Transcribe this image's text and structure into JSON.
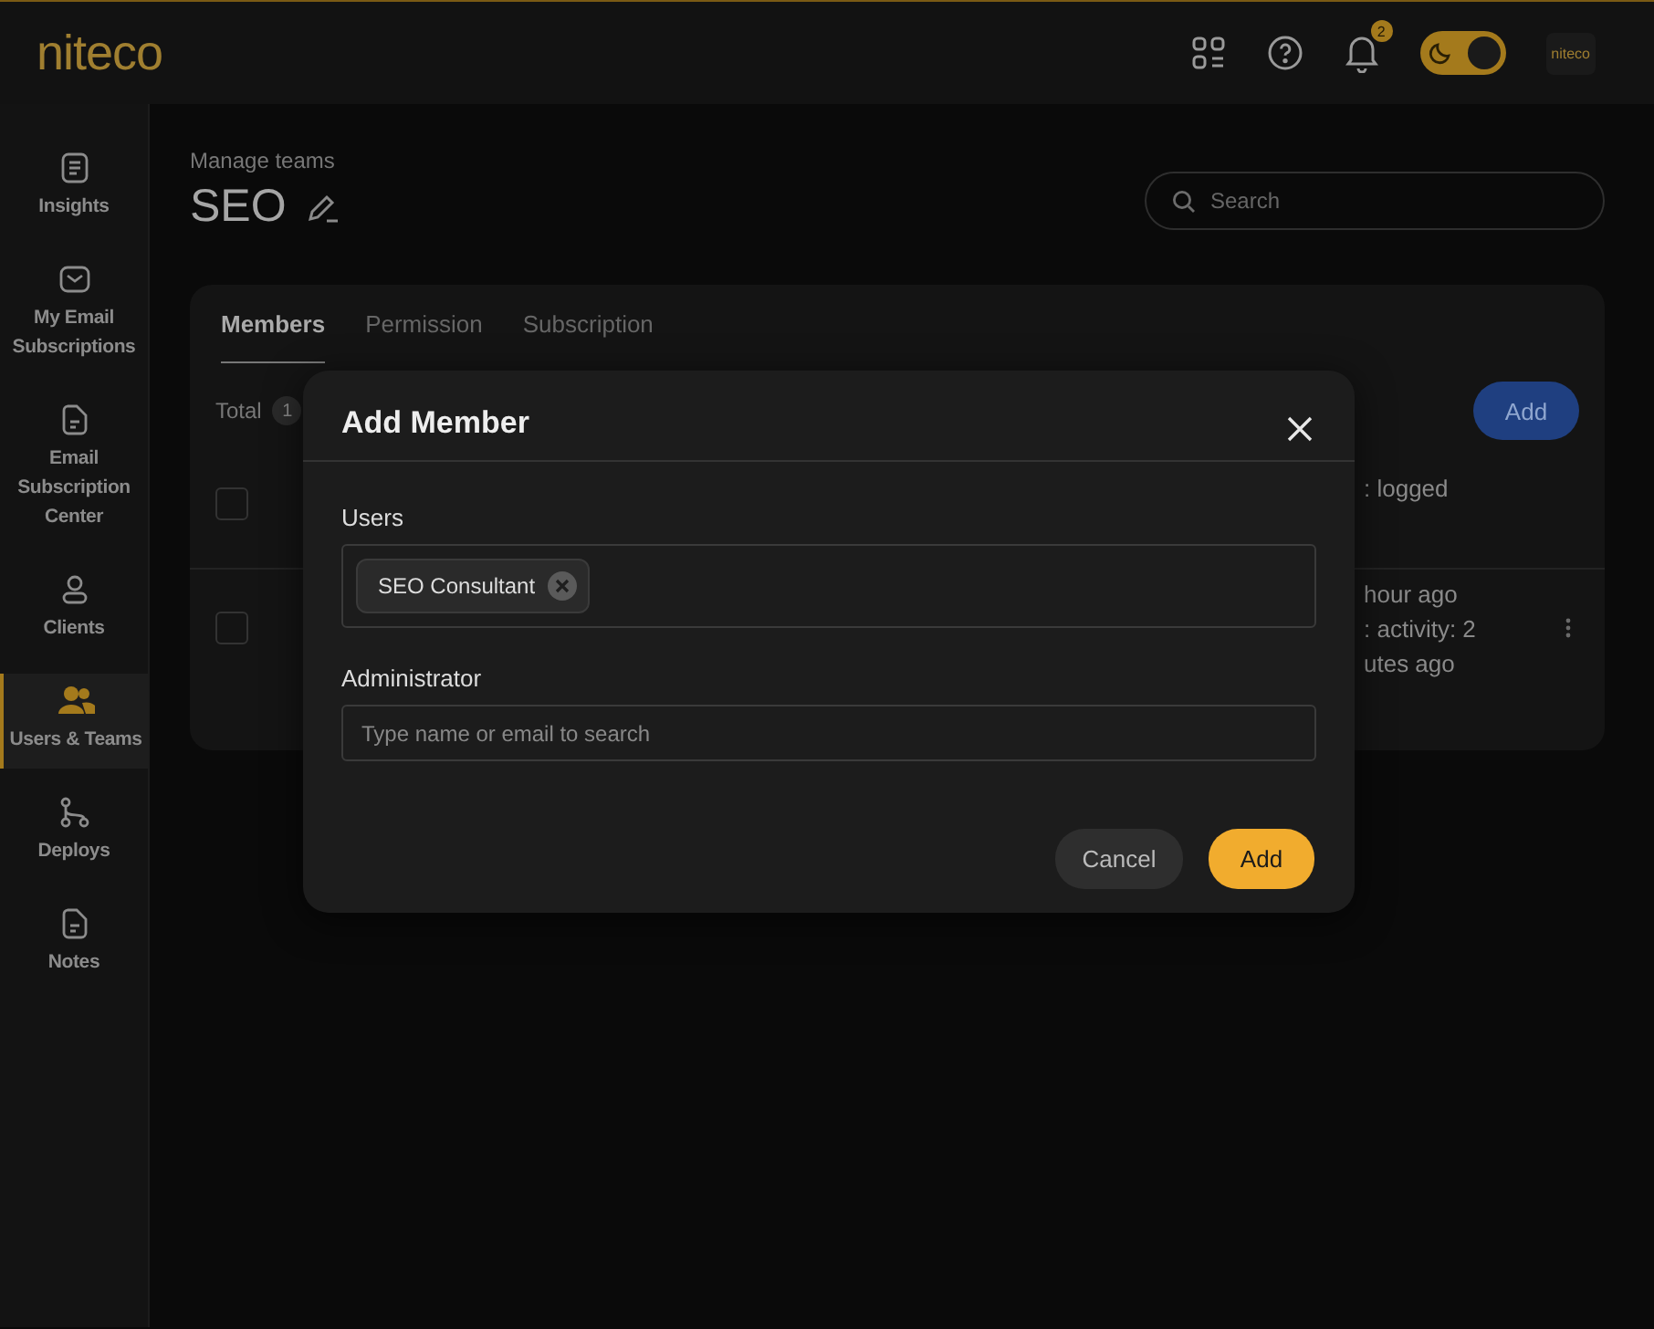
{
  "header": {
    "logo": "niteco",
    "notifications": {
      "count": "2"
    },
    "theme_toggle": {
      "on": true
    },
    "avatar": "niteco"
  },
  "sidebar": {
    "items": [
      {
        "label": "Insights",
        "selected": false
      },
      {
        "label": "My Email Subscriptions",
        "selected": false
      },
      {
        "label": "Email Subscription Center",
        "selected": false
      },
      {
        "label": "Clients",
        "selected": false
      },
      {
        "label": "Users & Teams",
        "selected": true
      },
      {
        "label": "Deploys",
        "selected": false
      },
      {
        "label": "Notes",
        "selected": false
      }
    ]
  },
  "page": {
    "breadcrumb": "Manage teams",
    "title": "SEO",
    "search": {
      "placeholder": "Search"
    }
  },
  "tabs": [
    {
      "label": "Members",
      "selected": true
    },
    {
      "label": "Permission",
      "selected": false
    },
    {
      "label": "Subscription",
      "selected": false
    }
  ],
  "toolbar": {
    "total_label": "Total",
    "total_count": "1",
    "add_button": "Add"
  },
  "table": {
    "header": {
      "checked": false,
      "column_2": [
        ": logged"
      ]
    },
    "rows": [
      {
        "checked": false,
        "column_2": [
          "hour ago",
          ": activity: 2",
          "utes ago"
        ]
      }
    ]
  },
  "dialog": {
    "title": "Add Member",
    "fields": [
      {
        "kind": "chips",
        "label": "Users",
        "chips": [
          "SEO Consultant"
        ]
      },
      {
        "kind": "text",
        "label": "Administrator",
        "placeholder": "Type name or email to search"
      }
    ],
    "buttons": [
      {
        "label": "Cancel",
        "kind": "secondary"
      },
      {
        "label": "Add",
        "kind": "primary"
      }
    ]
  }
}
